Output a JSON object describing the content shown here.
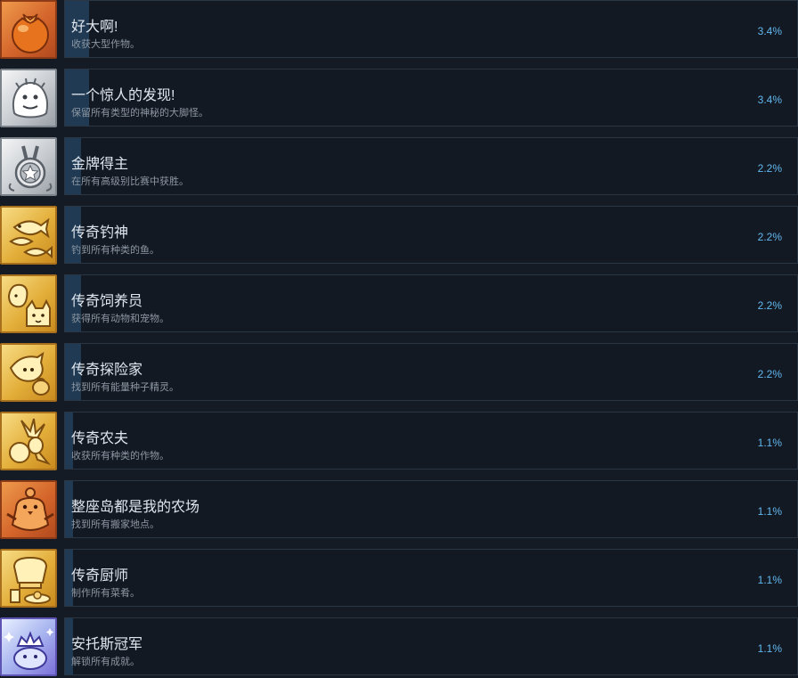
{
  "achievements": [
    {
      "title": "好大啊!",
      "description": "收获大型作物。",
      "percent": "3.4%",
      "fill": 0.034,
      "icon": "tomato-icon",
      "tier": "orange"
    },
    {
      "title": "一个惊人的发现!",
      "description": "保留所有类型的神秘的大脚怪。",
      "percent": "3.4%",
      "fill": 0.034,
      "icon": "bigfoot-icon",
      "tier": "silver"
    },
    {
      "title": "金牌得主",
      "description": "在所有高级别比赛中获胜。",
      "percent": "2.2%",
      "fill": 0.022,
      "icon": "medal-icon",
      "tier": "silver"
    },
    {
      "title": "传奇钓神",
      "description": "钓到所有种类的鱼。",
      "percent": "2.2%",
      "fill": 0.022,
      "icon": "fish-icon",
      "tier": "gold"
    },
    {
      "title": "传奇饲养员",
      "description": "获得所有动物和宠物。",
      "percent": "2.2%",
      "fill": 0.022,
      "icon": "pets-icon",
      "tier": "gold"
    },
    {
      "title": "传奇探险家",
      "description": "找到所有能量种子精灵。",
      "percent": "2.2%",
      "fill": 0.022,
      "icon": "sprite-icon",
      "tier": "gold"
    },
    {
      "title": "传奇农夫",
      "description": "收获所有种类的作物。",
      "percent": "1.1%",
      "fill": 0.011,
      "icon": "crops-icon",
      "tier": "gold"
    },
    {
      "title": "整座岛都是我的农场",
      "description": "找到所有搬家地点。",
      "percent": "1.1%",
      "fill": 0.011,
      "icon": "bird-icon",
      "tier": "orange"
    },
    {
      "title": "传奇厨师",
      "description": "制作所有菜肴。",
      "percent": "1.1%",
      "fill": 0.011,
      "icon": "chef-hat-icon",
      "tier": "gold"
    },
    {
      "title": "安托斯冠军",
      "description": "解锁所有成就。",
      "percent": "1.1%",
      "fill": 0.011,
      "icon": "crown-icon",
      "tier": "purple"
    }
  ]
}
